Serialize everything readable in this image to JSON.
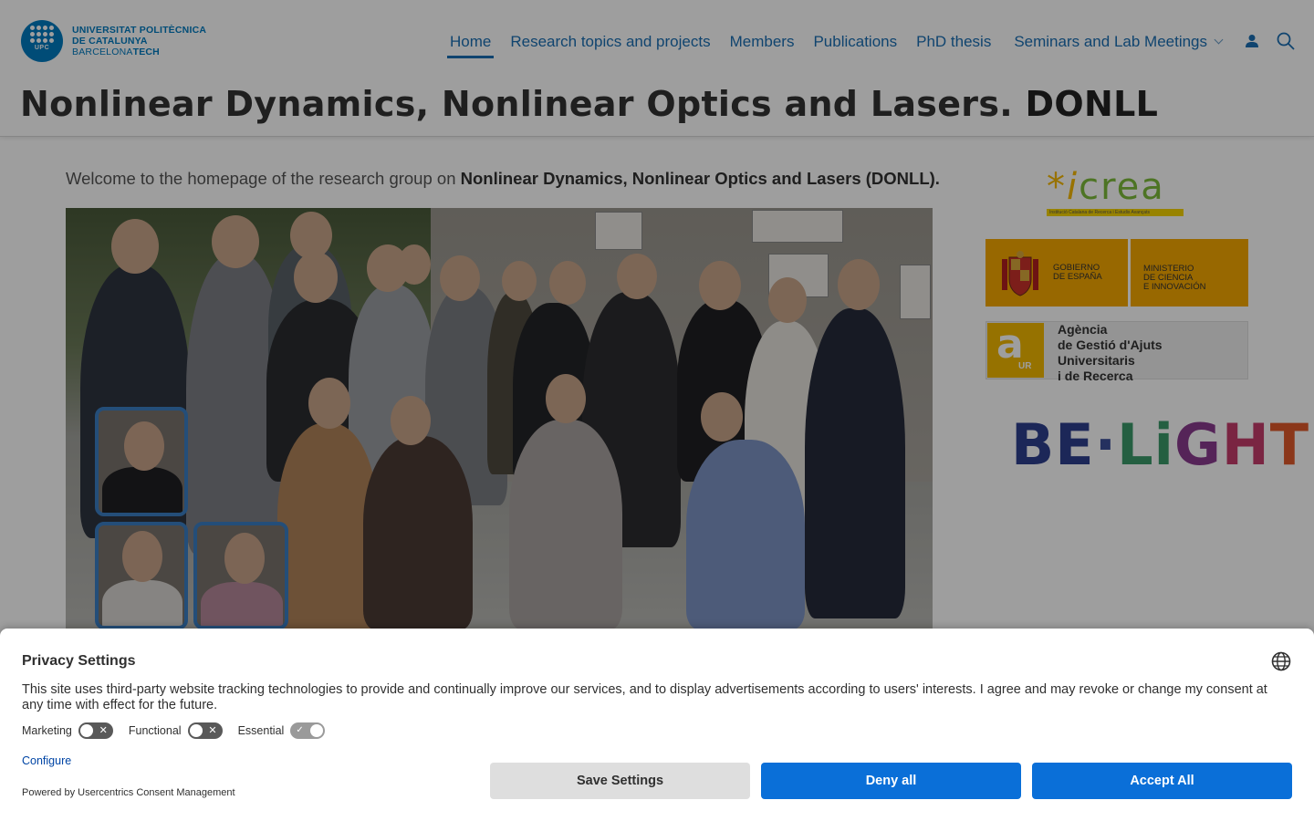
{
  "header": {
    "logo": {
      "line1": "UNIVERSITAT POLITÈCNICA",
      "line2": "DE CATALUNYA",
      "line3_light": "BARCELONA",
      "line3_bold": "TECH",
      "mark_text": "UPC"
    },
    "nav": {
      "home": "Home",
      "research": "Research topics and projects",
      "members": "Members",
      "publications": "Publications",
      "phd": "PhD thesis",
      "seminars": "Seminars and Lab Meetings"
    },
    "icons": {
      "user": "user-icon",
      "search": "search-icon",
      "dropdown": "chevron-down-icon"
    },
    "title_regular": "Nonlinear Dynamics, Nonlinear Optics and Lasers. ",
    "title_bold": "DONLL"
  },
  "main": {
    "welcome_prefix": "Welcome to the homepage of the research group on ",
    "welcome_bold": "Nonlinear Dynamics, Nonlinear Optics and Lasers (DONLL)."
  },
  "sidebar": {
    "icrea": {
      "star": "*",
      "i": "i",
      "rest": "crea",
      "tagline": "Institució Catalana de Recerca i Estudis Avançats"
    },
    "gobierno": {
      "left_line1": "GOBIERNO",
      "left_line2": "DE ESPAÑA",
      "right_line1": "MINISTERIO",
      "right_line2": "DE CIENCIA",
      "right_line3": "E INNOVACIÓN"
    },
    "agaur": {
      "mark": "a",
      "mark_sub": "UR",
      "line1": "Agència",
      "line2": "de Gestió d'Ajuts",
      "line3": "Universitaris",
      "line4": "i de Recerca"
    },
    "belight": {
      "p1": "BE",
      "p2": "·",
      "p3": "Li",
      "p4": "G",
      "p5": "H",
      "p6": "T"
    }
  },
  "consent": {
    "title": "Privacy Settings",
    "text": "This site uses third-party website tracking technologies to provide and continually improve our services, and to display advertisements according to users' interests. I agree and may revoke or change my consent at any time with effect for the future.",
    "toggles": {
      "marketing": "Marketing",
      "functional": "Functional",
      "essential": "Essential"
    },
    "configure": "Configure",
    "powered_by": "Powered by Usercentrics Consent Management",
    "buttons": {
      "save": "Save Settings",
      "deny": "Deny all",
      "accept": "Accept All"
    },
    "icons": {
      "language": "globe-icon"
    }
  }
}
